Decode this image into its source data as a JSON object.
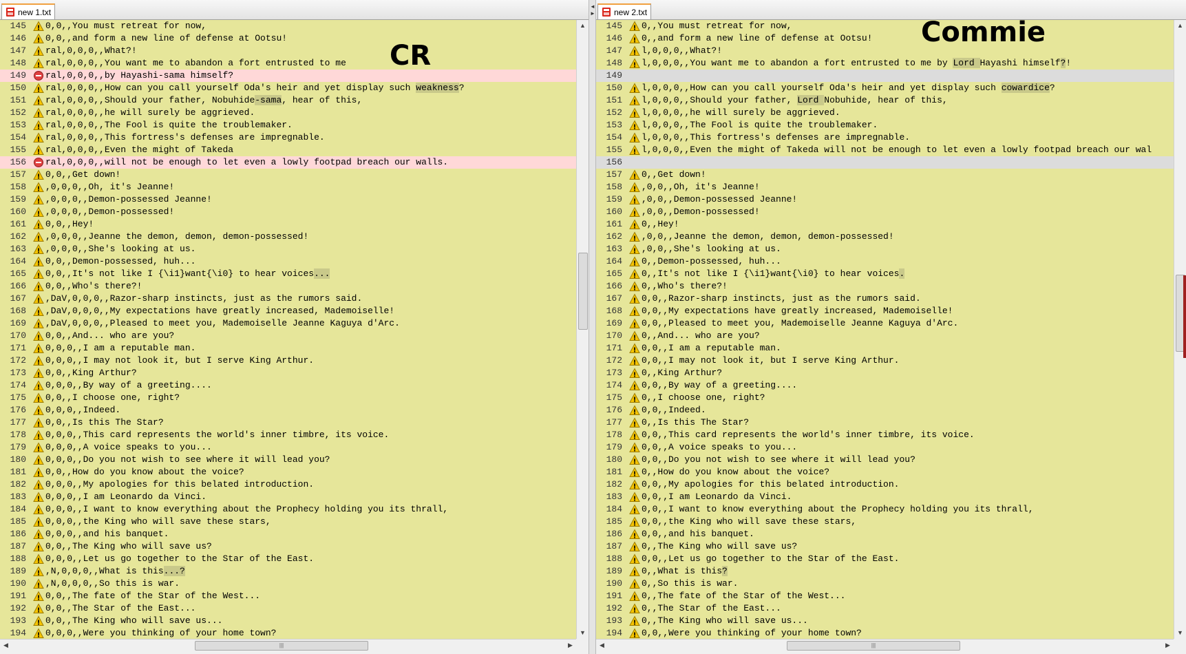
{
  "left_pane": {
    "tab": {
      "title": "new  1.txt"
    },
    "overlay_label": "CR",
    "lines": [
      {
        "n": "145",
        "status": "warn",
        "parts": [
          {
            "t": "0,0,,You must retreat for now,"
          }
        ]
      },
      {
        "n": "146",
        "status": "warn",
        "parts": [
          {
            "t": "0,0,,and form a new line of defense at Ootsu!"
          }
        ]
      },
      {
        "n": "147",
        "status": "warn",
        "parts": [
          {
            "t": "ral,0,0,0,,What?!"
          }
        ]
      },
      {
        "n": "148",
        "status": "warn",
        "parts": [
          {
            "t": "ral,0,0,0,,You want me to abandon a fort entrusted to me"
          }
        ]
      },
      {
        "n": "149",
        "status": "removed",
        "parts": [
          {
            "t": "ral,0,0,0,,by Hayashi-sama himself?"
          }
        ]
      },
      {
        "n": "150",
        "status": "warn",
        "parts": [
          {
            "t": "ral,0,0,0,,How can you call yourself Oda's heir and yet display such "
          },
          {
            "t": "weakness",
            "hl": true
          },
          {
            "t": "?"
          }
        ]
      },
      {
        "n": "151",
        "status": "warn",
        "parts": [
          {
            "t": "ral,0,0,0,,Should your father, Nobuhide"
          },
          {
            "t": "-sama",
            "hl": true
          },
          {
            "t": ", hear of this,"
          }
        ]
      },
      {
        "n": "152",
        "status": "warn",
        "parts": [
          {
            "t": "ral,0,0,0,,he will surely be aggrieved."
          }
        ]
      },
      {
        "n": "153",
        "status": "warn",
        "parts": [
          {
            "t": "ral,0,0,0,,The Fool is quite the troublemaker."
          }
        ]
      },
      {
        "n": "154",
        "status": "warn",
        "parts": [
          {
            "t": "ral,0,0,0,,This fortress's defenses are impregnable."
          }
        ]
      },
      {
        "n": "155",
        "status": "warn",
        "parts": [
          {
            "t": "ral,0,0,0,,Even the might of Takeda"
          }
        ]
      },
      {
        "n": "156",
        "status": "removed",
        "parts": [
          {
            "t": "ral,0,0,0,,will not be enough to let even a lowly footpad breach our walls."
          }
        ]
      },
      {
        "n": "157",
        "status": "warn",
        "parts": [
          {
            "t": "0,0,,Get down!"
          }
        ]
      },
      {
        "n": "158",
        "status": "warn",
        "parts": [
          {
            "t": ",0,0,0,,Oh, it's Jeanne!"
          }
        ]
      },
      {
        "n": "159",
        "status": "warn",
        "parts": [
          {
            "t": ",0,0,0,,Demon-possessed Jeanne!"
          }
        ]
      },
      {
        "n": "160",
        "status": "warn",
        "parts": [
          {
            "t": ",0,0,0,,Demon-possessed!"
          }
        ]
      },
      {
        "n": "161",
        "status": "warn",
        "parts": [
          {
            "t": "0,0,,Hey!"
          }
        ]
      },
      {
        "n": "162",
        "status": "warn",
        "parts": [
          {
            "t": ",0,0,0,,Jeanne the demon, demon, demon-possessed!"
          }
        ]
      },
      {
        "n": "163",
        "status": "warn",
        "parts": [
          {
            "t": ",0,0,0,,She's looking at us."
          }
        ]
      },
      {
        "n": "164",
        "status": "warn",
        "parts": [
          {
            "t": "0,0,,Demon-possessed, huh..."
          }
        ]
      },
      {
        "n": "165",
        "status": "warn",
        "parts": [
          {
            "t": "0,0,,It's not like I {\\i1}want{\\i0} to hear voices"
          },
          {
            "t": "...",
            "hl": true
          }
        ]
      },
      {
        "n": "166",
        "status": "warn",
        "parts": [
          {
            "t": "0,0,,Who's there?!"
          }
        ]
      },
      {
        "n": "167",
        "status": "warn",
        "parts": [
          {
            "t": ",DaV,0,0,0,,Razor-sharp instincts, just as the rumors said."
          }
        ]
      },
      {
        "n": "168",
        "status": "warn",
        "parts": [
          {
            "t": ",DaV,0,0,0,,My expectations have greatly increased, Mademoiselle!"
          }
        ]
      },
      {
        "n": "169",
        "status": "warn",
        "parts": [
          {
            "t": ",DaV,0,0,0,,Pleased to meet you, Mademoiselle Jeanne Kaguya d'Arc."
          }
        ]
      },
      {
        "n": "170",
        "status": "warn",
        "parts": [
          {
            "t": "0,0,,And... who are you?"
          }
        ]
      },
      {
        "n": "171",
        "status": "warn",
        "parts": [
          {
            "t": "0,0,0,,I am a reputable man."
          }
        ]
      },
      {
        "n": "172",
        "status": "warn",
        "parts": [
          {
            "t": "0,0,0,,I may not look it, but I serve King Arthur."
          }
        ]
      },
      {
        "n": "173",
        "status": "warn",
        "parts": [
          {
            "t": "0,0,,King Arthur?"
          }
        ]
      },
      {
        "n": "174",
        "status": "warn",
        "parts": [
          {
            "t": "0,0,0,,By way of a greeting...."
          }
        ]
      },
      {
        "n": "175",
        "status": "warn",
        "parts": [
          {
            "t": "0,0,,I choose one, right?"
          }
        ]
      },
      {
        "n": "176",
        "status": "warn",
        "parts": [
          {
            "t": "0,0,0,,Indeed."
          }
        ]
      },
      {
        "n": "177",
        "status": "warn",
        "parts": [
          {
            "t": "0,0,,Is this The Star?"
          }
        ]
      },
      {
        "n": "178",
        "status": "warn",
        "parts": [
          {
            "t": "0,0,0,,This card represents the world's inner timbre, its voice."
          }
        ]
      },
      {
        "n": "179",
        "status": "warn",
        "parts": [
          {
            "t": "0,0,0,,A voice speaks to you..."
          }
        ]
      },
      {
        "n": "180",
        "status": "warn",
        "parts": [
          {
            "t": "0,0,0,,Do you not wish to see where it will lead you?"
          }
        ]
      },
      {
        "n": "181",
        "status": "warn",
        "parts": [
          {
            "t": "0,0,,How do you know about the voice?"
          }
        ]
      },
      {
        "n": "182",
        "status": "warn",
        "parts": [
          {
            "t": "0,0,0,,My apologies for this belated introduction."
          }
        ]
      },
      {
        "n": "183",
        "status": "warn",
        "parts": [
          {
            "t": "0,0,0,,I am Leonardo da Vinci."
          }
        ]
      },
      {
        "n": "184",
        "status": "warn",
        "parts": [
          {
            "t": "0,0,0,,I want to know everything about the Prophecy holding you its thrall,"
          }
        ]
      },
      {
        "n": "185",
        "status": "warn",
        "parts": [
          {
            "t": "0,0,0,,the King who will save these stars,"
          }
        ]
      },
      {
        "n": "186",
        "status": "warn",
        "parts": [
          {
            "t": "0,0,0,,and his banquet."
          }
        ]
      },
      {
        "n": "187",
        "status": "warn",
        "parts": [
          {
            "t": "0,0,,The King who will save us?"
          }
        ]
      },
      {
        "n": "188",
        "status": "warn",
        "parts": [
          {
            "t": "0,0,0,,Let us go together to the Star of the East."
          }
        ]
      },
      {
        "n": "189",
        "status": "warn",
        "parts": [
          {
            "t": ",N,0,0,0,,What is this"
          },
          {
            "t": "...?",
            "hl": true
          }
        ]
      },
      {
        "n": "190",
        "status": "warn",
        "parts": [
          {
            "t": ",N,0,0,0,,So this is war."
          }
        ]
      },
      {
        "n": "191",
        "status": "warn",
        "parts": [
          {
            "t": "0,0,,The fate of the Star of the West..."
          }
        ]
      },
      {
        "n": "192",
        "status": "warn",
        "parts": [
          {
            "t": "0,0,,The Star of the East..."
          }
        ]
      },
      {
        "n": "193",
        "status": "warn",
        "parts": [
          {
            "t": "0,0,,The King who will save us..."
          }
        ]
      },
      {
        "n": "194",
        "status": "warn",
        "parts": [
          {
            "t": "0,0,0,,Were you thinking of your home town?"
          }
        ]
      }
    ]
  },
  "right_pane": {
    "tab": {
      "title": "new  2.txt"
    },
    "overlay_label": "Commie",
    "lines": [
      {
        "n": "145",
        "status": "warn",
        "parts": [
          {
            "t": "0,,You must retreat for now,"
          }
        ]
      },
      {
        "n": "146",
        "status": "warn",
        "parts": [
          {
            "t": "0,,and form a new line of defense at Ootsu!"
          }
        ]
      },
      {
        "n": "147",
        "status": "warn",
        "parts": [
          {
            "t": "l,0,0,0,,What?!"
          }
        ]
      },
      {
        "n": "148",
        "status": "warn",
        "parts": [
          {
            "t": "l,0,0,0,,You want me to abandon a fort entrusted to me by "
          },
          {
            "t": "Lord ",
            "hl": true
          },
          {
            "t": "Hayashi himself"
          },
          {
            "t": "?",
            "hl": true
          },
          {
            "t": "!"
          }
        ]
      },
      {
        "n": "149",
        "status": "blank",
        "parts": []
      },
      {
        "n": "150",
        "status": "warn",
        "parts": [
          {
            "t": "l,0,0,0,,How can you call yourself Oda's heir and yet display such "
          },
          {
            "t": "cowardice",
            "hl": true
          },
          {
            "t": "?"
          }
        ]
      },
      {
        "n": "151",
        "status": "warn",
        "parts": [
          {
            "t": "l,0,0,0,,Should your father, "
          },
          {
            "t": "Lord ",
            "hl": true
          },
          {
            "t": "Nobuhide, hear of this,"
          }
        ]
      },
      {
        "n": "152",
        "status": "warn",
        "parts": [
          {
            "t": "l,0,0,0,,he will surely be aggrieved."
          }
        ]
      },
      {
        "n": "153",
        "status": "warn",
        "parts": [
          {
            "t": "l,0,0,0,,The Fool is quite the troublemaker."
          }
        ]
      },
      {
        "n": "154",
        "status": "warn",
        "parts": [
          {
            "t": "l,0,0,0,,This fortress's defenses are impregnable."
          }
        ]
      },
      {
        "n": "155",
        "status": "warn",
        "parts": [
          {
            "t": "l,0,0,0,,Even the might of Takeda will not be enough to let even a lowly footpad breach our wal"
          }
        ]
      },
      {
        "n": "156",
        "status": "blank",
        "parts": []
      },
      {
        "n": "157",
        "status": "warn",
        "parts": [
          {
            "t": "0,,Get down!"
          }
        ]
      },
      {
        "n": "158",
        "status": "warn",
        "parts": [
          {
            "t": ",0,0,,Oh, it's Jeanne!"
          }
        ]
      },
      {
        "n": "159",
        "status": "warn",
        "parts": [
          {
            "t": ",0,0,,Demon-possessed Jeanne!"
          }
        ]
      },
      {
        "n": "160",
        "status": "warn",
        "parts": [
          {
            "t": ",0,0,,Demon-possessed!"
          }
        ]
      },
      {
        "n": "161",
        "status": "warn",
        "parts": [
          {
            "t": "0,,Hey!"
          }
        ]
      },
      {
        "n": "162",
        "status": "warn",
        "parts": [
          {
            "t": ",0,0,,Jeanne the demon, demon, demon-possessed!"
          }
        ]
      },
      {
        "n": "163",
        "status": "warn",
        "parts": [
          {
            "t": ",0,0,,She's looking at us."
          }
        ]
      },
      {
        "n": "164",
        "status": "warn",
        "parts": [
          {
            "t": "0,,Demon-possessed, huh..."
          }
        ]
      },
      {
        "n": "165",
        "status": "warn",
        "parts": [
          {
            "t": "0,,It's not like I {\\i1}want{\\i0} to hear voices"
          },
          {
            "t": ".",
            "hl": true
          }
        ]
      },
      {
        "n": "166",
        "status": "warn",
        "parts": [
          {
            "t": "0,,Who's there?!"
          }
        ]
      },
      {
        "n": "167",
        "status": "warn",
        "parts": [
          {
            "t": "0,0,,Razor-sharp instincts, just as the rumors said."
          }
        ]
      },
      {
        "n": "168",
        "status": "warn",
        "parts": [
          {
            "t": "0,0,,My expectations have greatly increased, Mademoiselle!"
          }
        ]
      },
      {
        "n": "169",
        "status": "warn",
        "parts": [
          {
            "t": "0,0,,Pleased to meet you, Mademoiselle Jeanne Kaguya d'Arc."
          }
        ]
      },
      {
        "n": "170",
        "status": "warn",
        "parts": [
          {
            "t": "0,,And... who are you?"
          }
        ]
      },
      {
        "n": "171",
        "status": "warn",
        "parts": [
          {
            "t": "0,0,,I am a reputable man."
          }
        ]
      },
      {
        "n": "172",
        "status": "warn",
        "parts": [
          {
            "t": "0,0,,I may not look it, but I serve King Arthur."
          }
        ]
      },
      {
        "n": "173",
        "status": "warn",
        "parts": [
          {
            "t": "0,,King Arthur?"
          }
        ]
      },
      {
        "n": "174",
        "status": "warn",
        "parts": [
          {
            "t": "0,0,,By way of a greeting...."
          }
        ]
      },
      {
        "n": "175",
        "status": "warn",
        "parts": [
          {
            "t": "0,,I choose one, right?"
          }
        ]
      },
      {
        "n": "176",
        "status": "warn",
        "parts": [
          {
            "t": "0,0,,Indeed."
          }
        ]
      },
      {
        "n": "177",
        "status": "warn",
        "parts": [
          {
            "t": "0,,Is this The Star?"
          }
        ]
      },
      {
        "n": "178",
        "status": "warn",
        "parts": [
          {
            "t": "0,0,,This card represents the world's inner timbre, its voice."
          }
        ]
      },
      {
        "n": "179",
        "status": "warn",
        "parts": [
          {
            "t": "0,0,,A voice speaks to you..."
          }
        ]
      },
      {
        "n": "180",
        "status": "warn",
        "parts": [
          {
            "t": "0,0,,Do you not wish to see where it will lead you?"
          }
        ]
      },
      {
        "n": "181",
        "status": "warn",
        "parts": [
          {
            "t": "0,,How do you know about the voice?"
          }
        ]
      },
      {
        "n": "182",
        "status": "warn",
        "parts": [
          {
            "t": "0,0,,My apologies for this belated introduction."
          }
        ]
      },
      {
        "n": "183",
        "status": "warn",
        "parts": [
          {
            "t": "0,0,,I am Leonardo da Vinci."
          }
        ]
      },
      {
        "n": "184",
        "status": "warn",
        "parts": [
          {
            "t": "0,0,,I want to know everything about the Prophecy holding you its thrall,"
          }
        ]
      },
      {
        "n": "185",
        "status": "warn",
        "parts": [
          {
            "t": "0,0,,the King who will save these stars,"
          }
        ]
      },
      {
        "n": "186",
        "status": "warn",
        "parts": [
          {
            "t": "0,0,,and his banquet."
          }
        ]
      },
      {
        "n": "187",
        "status": "warn",
        "parts": [
          {
            "t": "0,,The King who will save us?"
          }
        ]
      },
      {
        "n": "188",
        "status": "warn",
        "parts": [
          {
            "t": "0,0,,Let us go together to the Star of the East."
          }
        ]
      },
      {
        "n": "189",
        "status": "warn",
        "parts": [
          {
            "t": "0,,What is this"
          },
          {
            "t": "?",
            "hl": true
          }
        ]
      },
      {
        "n": "190",
        "status": "warn",
        "parts": [
          {
            "t": "0,,So this is war."
          }
        ]
      },
      {
        "n": "191",
        "status": "warn",
        "parts": [
          {
            "t": "0,,The fate of the Star of the West..."
          }
        ]
      },
      {
        "n": "192",
        "status": "warn",
        "parts": [
          {
            "t": "0,,The Star of the East..."
          }
        ]
      },
      {
        "n": "193",
        "status": "warn",
        "parts": [
          {
            "t": "0,,The King who will save us..."
          }
        ]
      },
      {
        "n": "194",
        "status": "warn",
        "parts": [
          {
            "t": "0,0,,Were you thinking of your home town?"
          }
        ]
      }
    ]
  },
  "icons": {
    "warn": "warning-triangle-icon",
    "removed": "deleted-line-icon",
    "file": "file-icon"
  },
  "colors": {
    "editor_bg": "#e6e69a",
    "removed_bg": "#ffd8d8",
    "blank_bg": "#dcdcdc",
    "highlight": "#c9c98a"
  }
}
